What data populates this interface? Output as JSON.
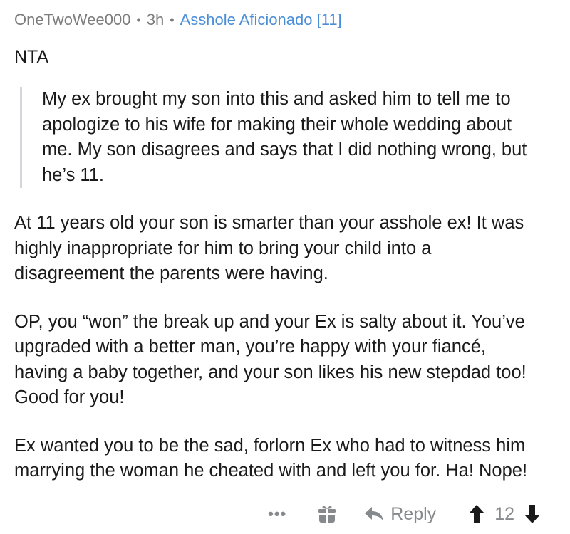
{
  "comment": {
    "username": "OneTwoWee000",
    "separator": "•",
    "age": "3h",
    "flair": "Asshole Aficionado [11]",
    "verdict": "NTA",
    "quote": "My ex brought my son into this and asked him to tell me to apologize to his wife for making their whole wedding about me. My son disagrees and says that I did nothing wrong, but he’s 11.",
    "paragraphs": [
      "At 11 years old your son is smarter than your asshole ex! It was highly inappropriate for him to bring your child into a disagreement the parents were having.",
      "OP, you “won” the break up and your Ex is salty about it. You’ve upgraded with a better man, you’re happy with your fiancé, having a baby together, and your son likes his new stepdad too! Good for you!",
      "Ex wanted you to be the sad, forlorn Ex who had to witness him marrying the woman he cheated with and left you for. Ha! Nope!"
    ]
  },
  "actions": {
    "more_label": "•••",
    "award_icon": "award-icon",
    "reply_icon": "reply-icon",
    "reply_label": "Reply",
    "upvote_icon": "upvote-icon",
    "score": "12",
    "downvote_icon": "downvote-icon"
  },
  "colors": {
    "text": "#1a1a1b",
    "meta": "#7c7c7c",
    "flair": "#4a8ed8",
    "actions": "#878a8c",
    "quote_bar": "#d3d6da"
  }
}
